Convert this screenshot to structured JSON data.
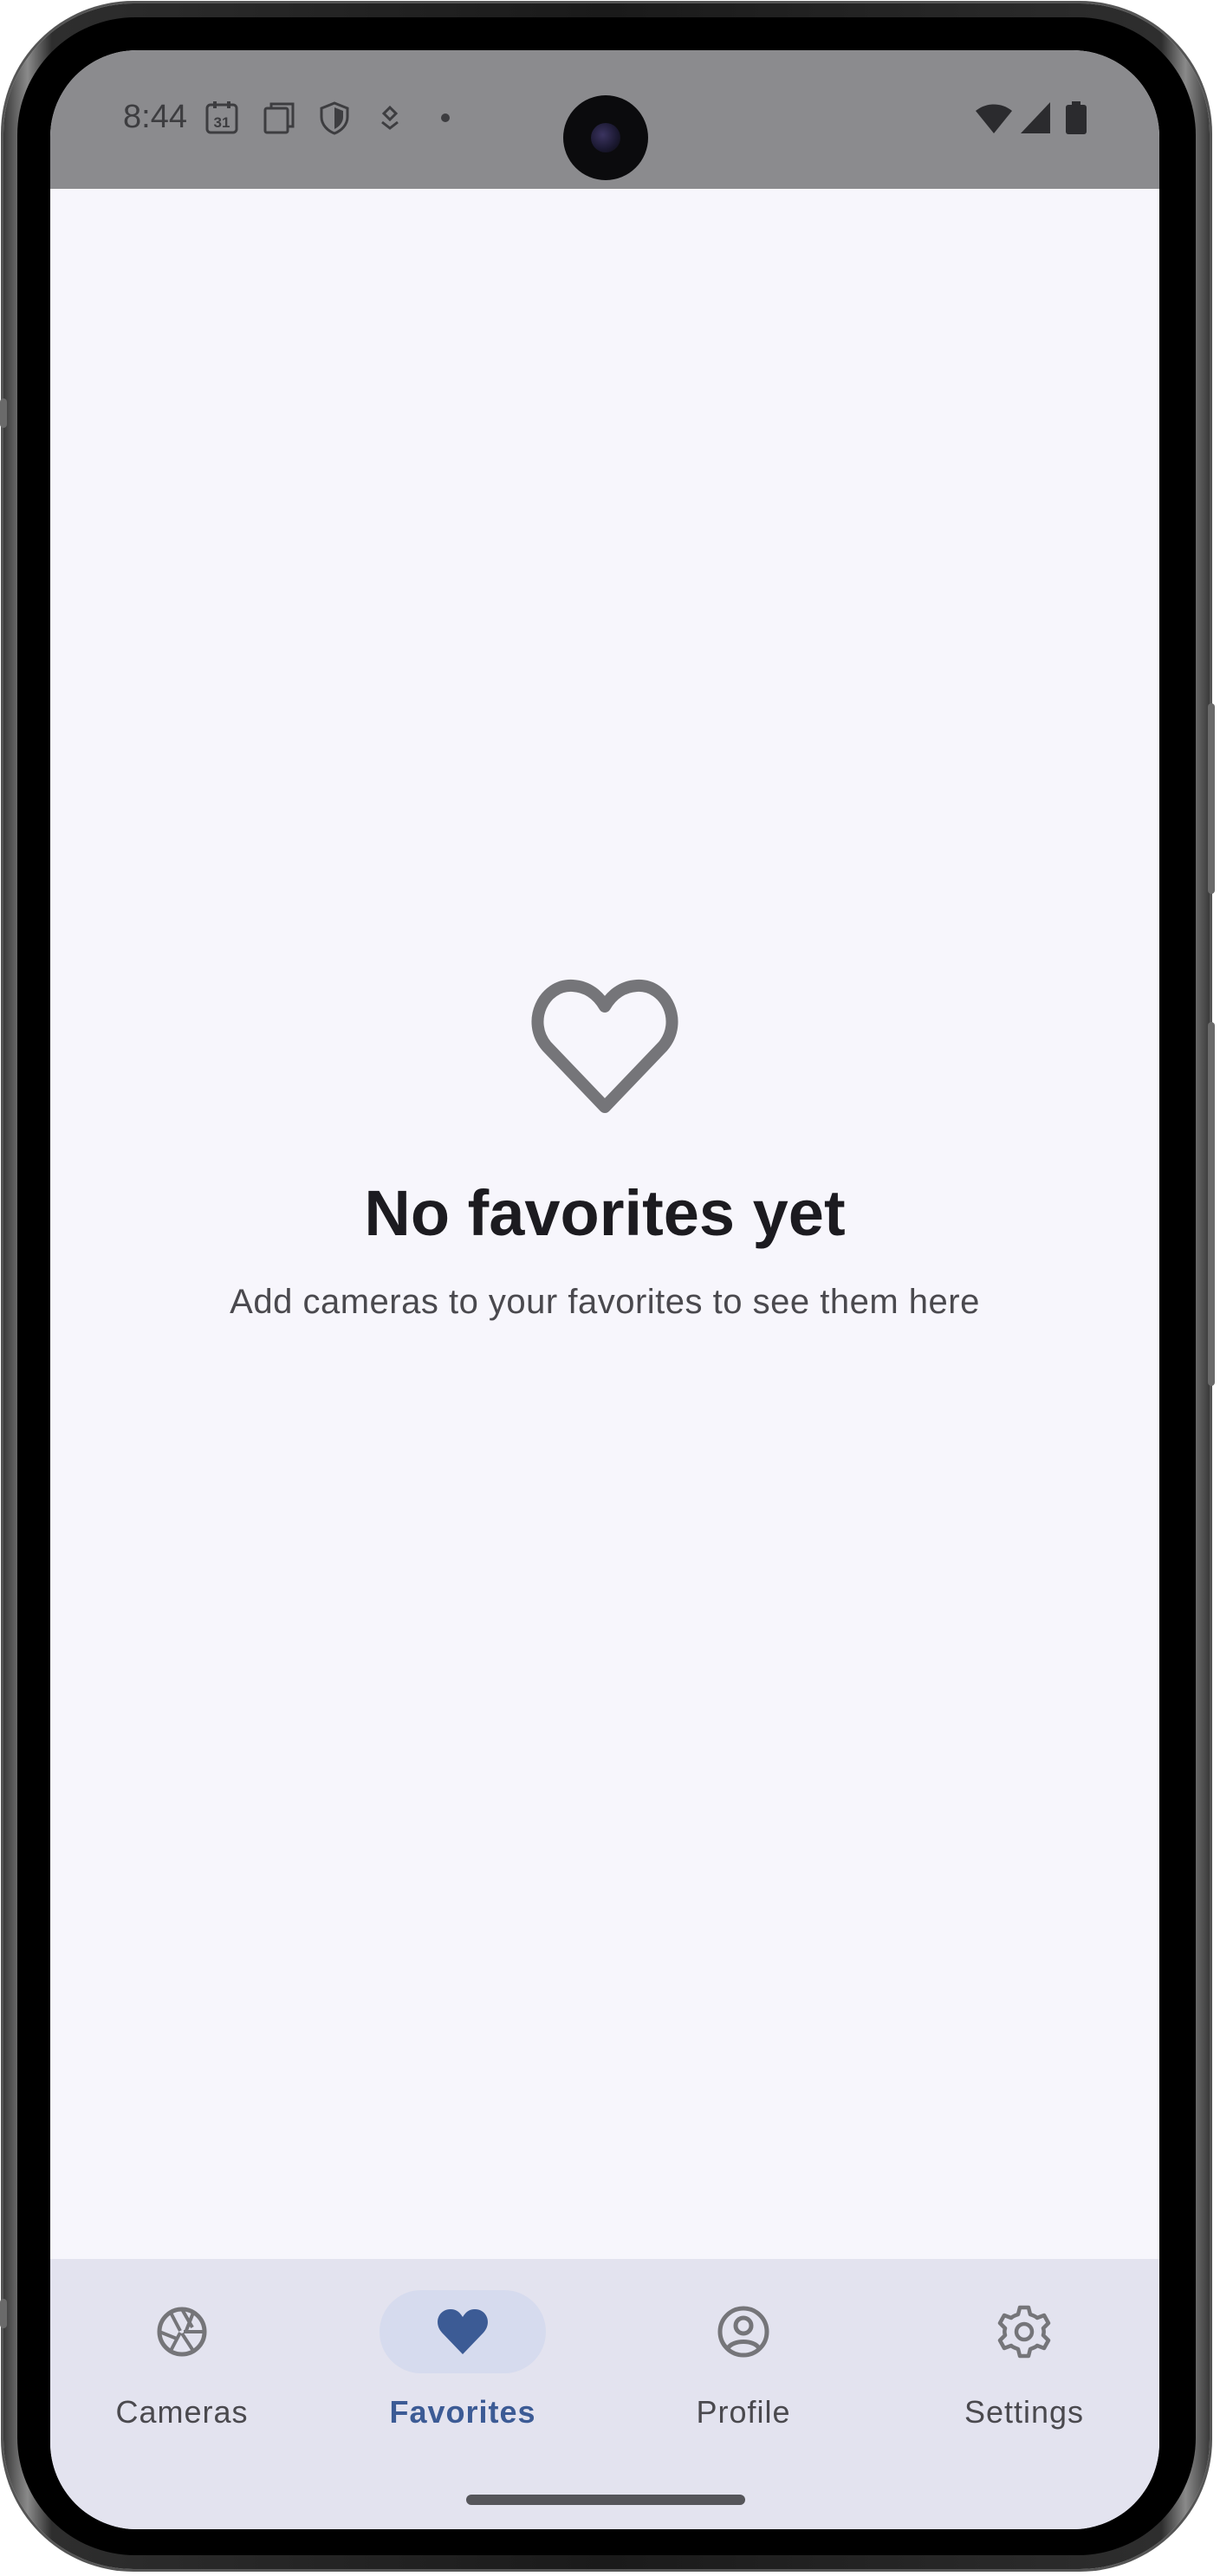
{
  "status_bar": {
    "time": "8:44",
    "icons": [
      "calendar-icon",
      "screen-copy-icon",
      "shield-icon",
      "location-pin-icon",
      "notification-dot-icon",
      "wifi-icon",
      "cell-signal-icon",
      "battery-icon"
    ],
    "calendar_day": "31"
  },
  "empty_state": {
    "icon": "heart-outline-icon",
    "title": "No favorites yet",
    "subtitle": "Add cameras to your favorites to see them here"
  },
  "bottom_nav": {
    "items": [
      {
        "label": "Cameras",
        "icon": "camera-aperture-icon",
        "active": false
      },
      {
        "label": "Favorites",
        "icon": "heart-filled-icon",
        "active": true
      },
      {
        "label": "Profile",
        "icon": "account-circle-icon",
        "active": false
      },
      {
        "label": "Settings",
        "icon": "gear-icon",
        "active": false
      }
    ]
  },
  "colors": {
    "status_bar_bg": "#8b8b8e",
    "screen_bg": "#f7f6fc",
    "nav_bg": "#e3e3ef",
    "active_accent": "#3c5b95",
    "active_indicator": "#d6dbee",
    "icon_gray": "#757579"
  }
}
